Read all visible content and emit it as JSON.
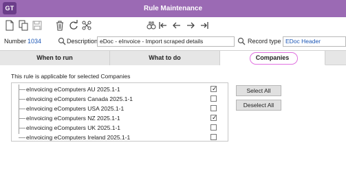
{
  "window": {
    "logo_text": "GT",
    "title": "Rule Maintenance"
  },
  "toolbar": {
    "icons": [
      "new-icon",
      "copy-icon",
      "save-icon",
      "delete-icon",
      "refresh-icon",
      "structure-icon",
      "binoculars-icon",
      "first-icon",
      "previous-icon",
      "next-icon",
      "last-icon"
    ]
  },
  "header": {
    "number_label": "Number",
    "number_value": "1034",
    "description_label": "Description",
    "description_value": "eDoc - eInvoice - Import scraped details",
    "record_type_label": "Record type",
    "record_type_value": "EDoc Header"
  },
  "tabs": [
    {
      "label": "When to run",
      "active": false
    },
    {
      "label": "What to do",
      "active": false
    },
    {
      "label": "Companies",
      "active": true
    }
  ],
  "content": {
    "info_text": "This rule is applicable for selected Companies",
    "companies": [
      {
        "name": "eInvoicing eComputers AU 2025.1-1",
        "checked": true
      },
      {
        "name": "eInvoicing eComputers Canada 2025.1-1",
        "checked": false
      },
      {
        "name": "eInvoicing eComputers USA 2025.1-1",
        "checked": false
      },
      {
        "name": "eInvoicing eComputers NZ 2025.1-1",
        "checked": true
      },
      {
        "name": "eInvoicing eComputers UK 2025.1-1",
        "checked": false
      },
      {
        "name": "eInvoicing eComputers Ireland 2025.1-1",
        "checked": false
      }
    ],
    "select_all_label": "Select All",
    "deselect_all_label": "Deselect All"
  }
}
